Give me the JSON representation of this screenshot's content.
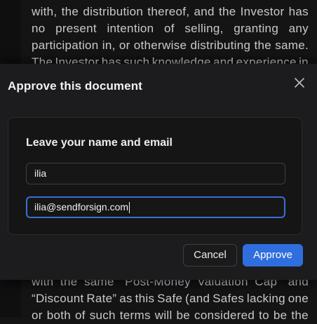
{
  "document": {
    "lines_top": [
      [
        "with,",
        "the",
        "distribution",
        "thereof,",
        "and",
        "the",
        "Investor",
        "has"
      ],
      [
        "no",
        "present",
        "intention",
        "of",
        "selling,",
        "granting",
        "any"
      ],
      [
        "participation",
        "in,",
        "or",
        "otherwise",
        "distributing",
        "the",
        "same."
      ],
      [
        "The",
        "Investor",
        "has",
        "such",
        "knowledge",
        "and",
        "experience",
        "in"
      ]
    ],
    "lines_bottom": [
      [
        "with",
        "the",
        "same",
        "“Post-Money",
        "Valuation",
        "Cap”",
        "and"
      ],
      [
        "“Discount",
        "Rate”",
        "as",
        "this",
        "Safe",
        "(and",
        "Safes",
        "lacking",
        "one"
      ],
      [
        "or",
        "both",
        "of",
        "such",
        "terms",
        "will",
        "be",
        "considered",
        "to",
        "be",
        "the"
      ]
    ]
  },
  "modal": {
    "title": "Approve this document",
    "close_icon": "close-icon",
    "panel_title": "Leave your name and email",
    "name_value": "ilia",
    "email_value": "ilia@sendforsign.com",
    "cancel_label": "Cancel",
    "approve_label": "Approve"
  },
  "colors": {
    "accent": "#2f6ede",
    "focus_border": "#3b6fd4",
    "modal_bg": "#1c1c1e",
    "page_bg": "#141414"
  }
}
